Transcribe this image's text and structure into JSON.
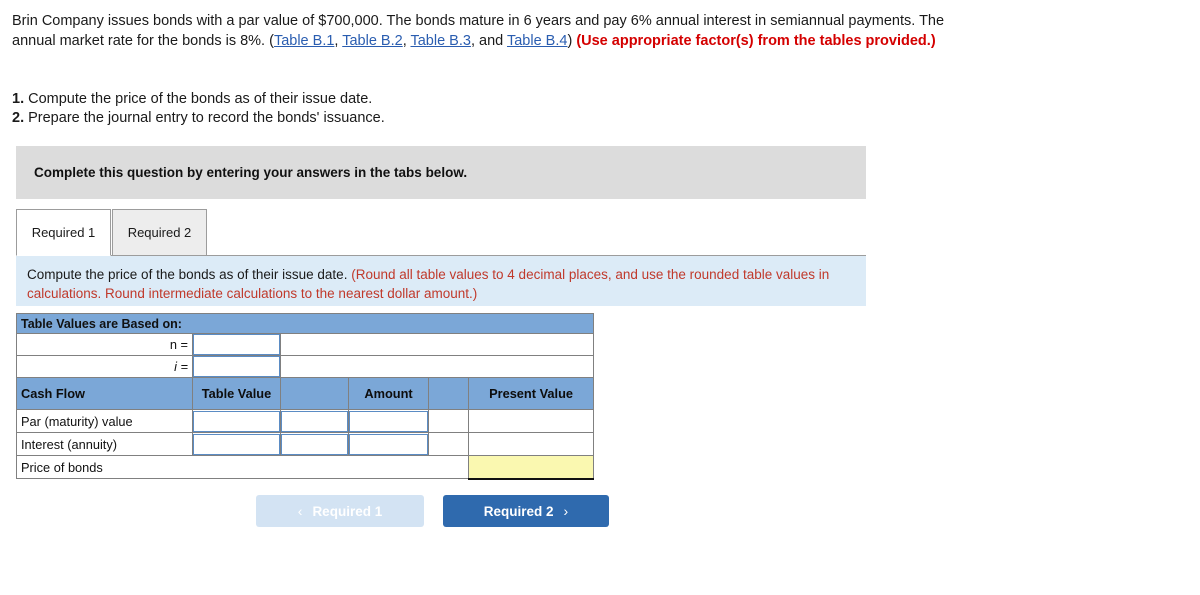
{
  "problem": {
    "part1": "Brin Company issues bonds with a par value of $700,000. The bonds mature in 6 years and pay 6% annual interest in semiannual payments. The annual market rate for the bonds is 8%. (",
    "link1": "Table B.1",
    "sep1": ", ",
    "link2": "Table B.2",
    "sep2": ", ",
    "link3": "Table B.3",
    "sep3": ", and ",
    "link4": "Table B.4",
    "close_paren": ") ",
    "emphasis": "(Use appropriate factor(s) from the tables provided.)"
  },
  "requirements": [
    {
      "num": "1.",
      "text": " Compute the price of the bonds as of their issue date."
    },
    {
      "num": "2.",
      "text": " Prepare the journal entry to record the bonds' issuance."
    }
  ],
  "banner": {
    "text": "Complete this question by entering your answers in the tabs below."
  },
  "tabs": [
    {
      "label": "Required 1",
      "active": true
    },
    {
      "label": "Required 2",
      "active": false
    }
  ],
  "instruction": {
    "main": "Compute the price of the bonds as of their issue date. ",
    "note": "(Round all table values to 4 decimal places, and use the rounded table values in calculations. Round intermediate calculations to the nearest dollar amount.)"
  },
  "worksheet": {
    "title": "Table Values are Based on:",
    "n_label": "n =",
    "n_value": "",
    "i_label": "i =",
    "i_value": "",
    "columns": {
      "cash_flow": "Cash Flow",
      "table_value": "Table Value",
      "op1": "",
      "amount": "Amount",
      "op2": "",
      "present_value": "Present Value"
    },
    "rows": [
      {
        "label": "Par (maturity) value",
        "table_value": "",
        "op1": "",
        "amount": "",
        "op2": "",
        "present_value": ""
      },
      {
        "label": "Interest (annuity)",
        "table_value": "",
        "op1": "",
        "amount": "",
        "op2": "",
        "present_value": ""
      }
    ],
    "total_row": {
      "label": "Price of bonds",
      "value": ""
    }
  },
  "nav": {
    "prev_label": "Required 1",
    "prev_chevron": "‹",
    "next_label": "Required 2",
    "next_chevron": "›"
  },
  "colors": {
    "header_blue": "#7ba7d7",
    "panel_blue": "#dcebf7",
    "banner_gray": "#dcdcdc",
    "highlight_yellow": "#faf8b0",
    "link_blue": "#2a5db0",
    "emphasis_red": "#d40000",
    "note_red": "#c0392b",
    "button_blue": "#2f6aae",
    "button_disabled": "#d3e3f3"
  }
}
